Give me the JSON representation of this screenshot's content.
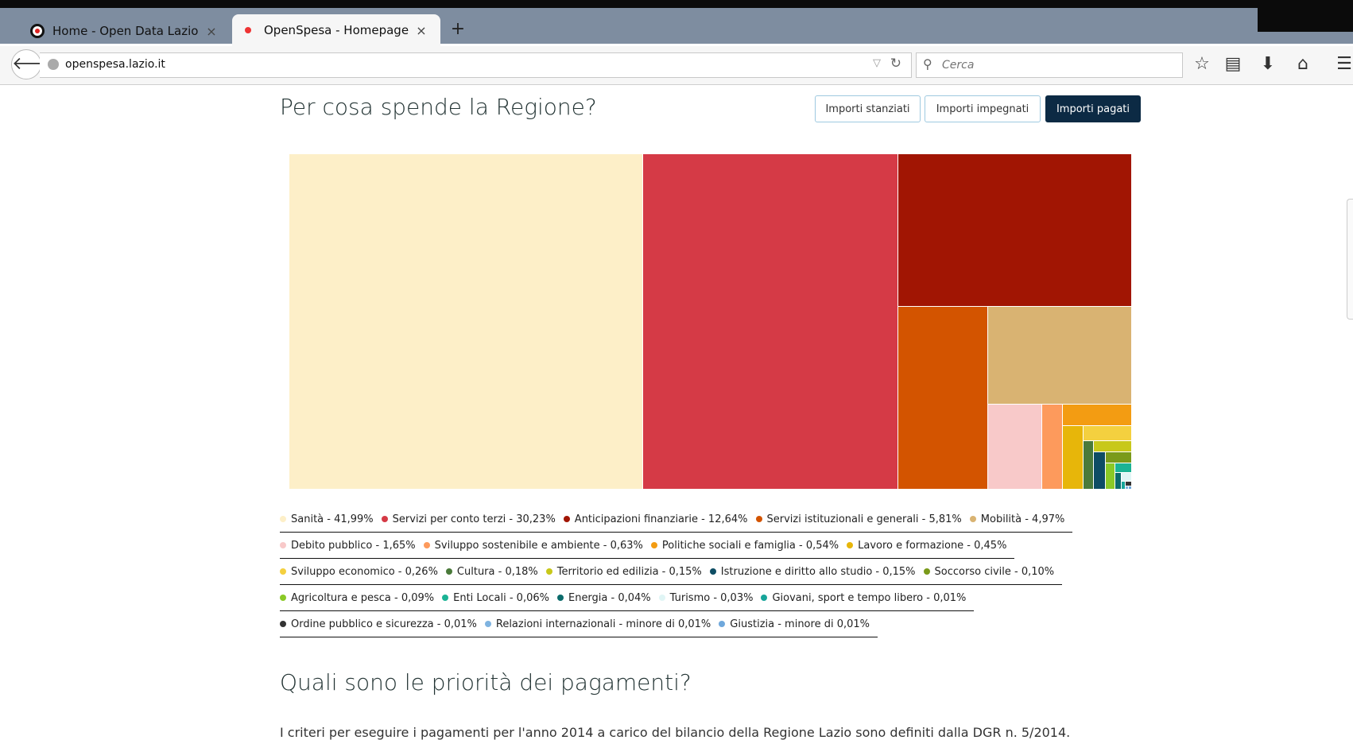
{
  "browser": {
    "tabs": [
      {
        "label": "Home - Open Data Lazio",
        "close": "×"
      },
      {
        "label": "OpenSpesa - Homepage",
        "close": "×"
      }
    ],
    "new_tab": "+",
    "back": "🡐",
    "url": "openspesa.lazio.it",
    "url_dropdown": "▽",
    "reload": "↻",
    "search_placeholder": "Cerca",
    "search_glyph": "⚲",
    "toolbar": {
      "bookmark": "☆",
      "reading_list": "▤",
      "download": "⬇",
      "home": "⌂",
      "menu": "☰"
    },
    "toolbar_icons": [
      "star-icon",
      "reading-list-icon",
      "download-icon",
      "home-icon",
      "menu-icon"
    ]
  },
  "page": {
    "title": "Per cosa spende la Regione?",
    "buttons": [
      "Importi stanziati",
      "Importi impegnati",
      "Importi pagati"
    ],
    "active_button": "Importi pagati",
    "section2_title": "Quali sono le priorità dei pagamenti?",
    "section2_text": "I criteri per eseguire i pagamenti per l'anno 2014 a carico del bilancio della Regione Lazio sono definiti dalla DGR n. 5/2014."
  },
  "chart_data": {
    "type": "treemap",
    "unit": "%",
    "items": [
      {
        "name": "Sanità",
        "value": 41.99,
        "label": "Sanità - 41,99%",
        "color": "#fdefc8"
      },
      {
        "name": "Servizi per conto terzi",
        "value": 30.23,
        "label": "Servizi per conto terzi - 30,23%",
        "color": "#d53a46"
      },
      {
        "name": "Anticipazioni finanziarie",
        "value": 12.64,
        "label": "Anticipazioni finanziarie - 12,64%",
        "color": "#a11503"
      },
      {
        "name": "Servizi istituzionali e generali",
        "value": 5.81,
        "label": "Servizi istituzionali e generali - 5,81%",
        "color": "#d35400"
      },
      {
        "name": "Mobilità",
        "value": 4.97,
        "label": "Mobilità - 4,97%",
        "color": "#d9b372"
      },
      {
        "name": "Debito pubblico",
        "value": 1.65,
        "label": "Debito pubblico - 1,65%",
        "color": "#f8c9c9"
      },
      {
        "name": "Sviluppo sostenibile e ambiente",
        "value": 0.63,
        "label": "Sviluppo sostenibile e ambiente - 0,63%",
        "color": "#fd9a5c"
      },
      {
        "name": "Politiche sociali e famiglia",
        "value": 0.54,
        "label": "Politiche sociali e famiglia - 0,54%",
        "color": "#f39c12"
      },
      {
        "name": "Lavoro e formazione",
        "value": 0.45,
        "label": "Lavoro e formazione - 0,45%",
        "color": "#e7b60a"
      },
      {
        "name": "Sviluppo economico",
        "value": 0.26,
        "label": "Sviluppo economico - 0,26%",
        "color": "#f4d03f"
      },
      {
        "name": "Cultura",
        "value": 0.18,
        "label": "Cultura - 0,18%",
        "color": "#4a7a3a"
      },
      {
        "name": "Territorio ed edilizia",
        "value": 0.15,
        "label": "Territorio ed edilizia - 0,15%",
        "color": "#c8c81a"
      },
      {
        "name": "Istruzione e diritto allo studio",
        "value": 0.15,
        "label": "Istruzione e diritto allo studio - 0,15%",
        "color": "#0e4d64"
      },
      {
        "name": "Soccorso civile",
        "value": 0.1,
        "label": "Soccorso civile - 0,10%",
        "color": "#7a9a1a"
      },
      {
        "name": "Agricoltura e pesca",
        "value": 0.09,
        "label": "Agricoltura e pesca - 0,09%",
        "color": "#8ac926"
      },
      {
        "name": "Enti Locali",
        "value": 0.06,
        "label": "Enti Locali - 0,06%",
        "color": "#1ab394"
      },
      {
        "name": "Energia",
        "value": 0.04,
        "label": "Energia - 0,04%",
        "color": "#0b6b6b"
      },
      {
        "name": "Turismo",
        "value": 0.03,
        "label": "Turismo - 0,03%",
        "color": "#e0f5f5"
      },
      {
        "name": "Giovani, sport e tempo libero",
        "value": 0.01,
        "label": "Giovani, sport e tempo libero - 0,01%",
        "color": "#17a59a"
      },
      {
        "name": "Ordine pubblico e sicurezza",
        "value": 0.01,
        "label": "Ordine pubblico e sicurezza - 0,01%",
        "color": "#333333"
      },
      {
        "name": "Relazioni internazionali",
        "value": 0.0,
        "label": "Relazioni internazionali - minore di 0,01%",
        "color": "#7fb3e0"
      },
      {
        "name": "Giustizia",
        "value": 0.0,
        "label": "Giustizia - minore di 0,01%",
        "color": "#6fa8dc"
      }
    ],
    "legend_rows": [
      5,
      4,
      5,
      5,
      3
    ]
  }
}
